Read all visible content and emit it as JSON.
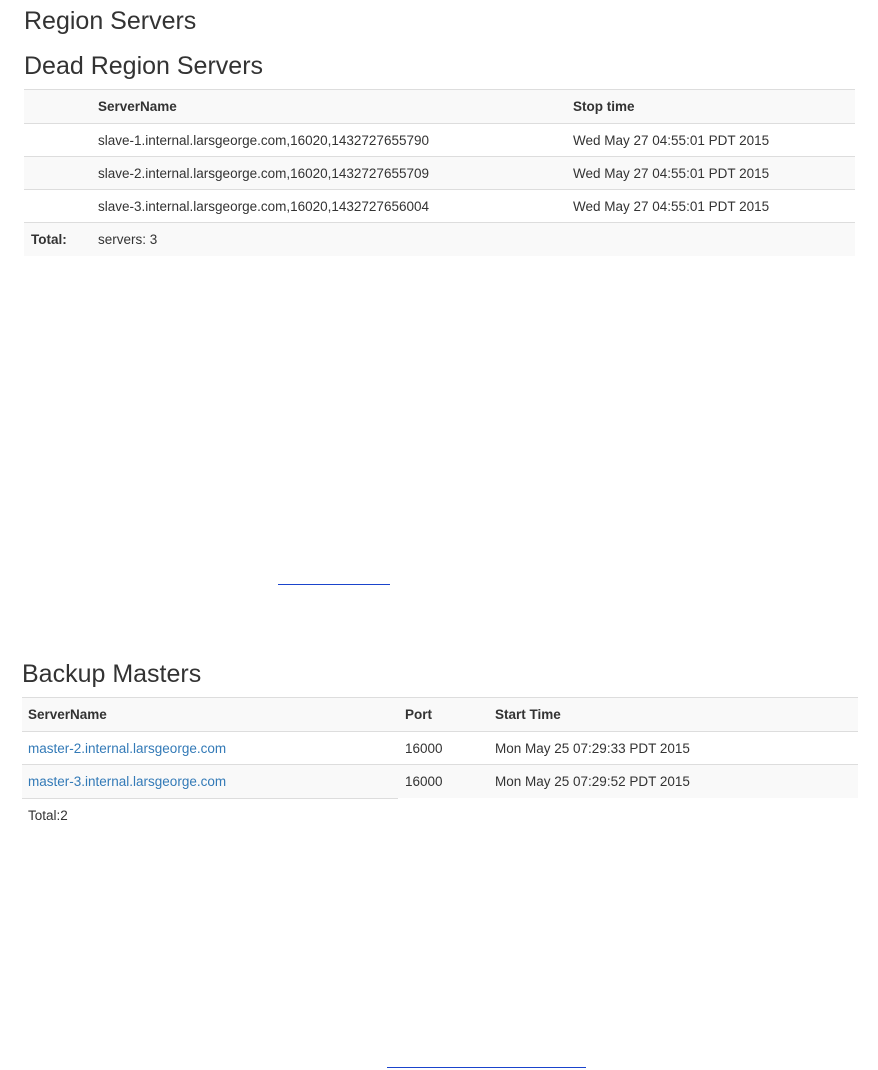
{
  "region_servers": {
    "title": "Region Servers"
  },
  "dead_region_servers": {
    "title": "Dead Region Servers",
    "columns": [
      "",
      "ServerName",
      "Stop time"
    ],
    "rows": [
      {
        "server": "slave-1.internal.larsgeorge.com,16020,1432727655790",
        "stop_time": "Wed May 27 04:55:01 PDT 2015"
      },
      {
        "server": "slave-2.internal.larsgeorge.com,16020,1432727655709",
        "stop_time": "Wed May 27 04:55:01 PDT 2015"
      },
      {
        "server": "slave-3.internal.larsgeorge.com,16020,1432727656004",
        "stop_time": "Wed May 27 04:55:01 PDT 2015"
      }
    ],
    "total_label": "Total:",
    "total_value": "servers: 3"
  },
  "backup_masters": {
    "title": "Backup Masters",
    "columns": [
      "ServerName",
      "Port",
      "Start Time"
    ],
    "rows": [
      {
        "server": "master-2.internal.larsgeorge.com",
        "port": "16000",
        "start_time": "Mon May 25 07:29:33 PDT 2015"
      },
      {
        "server": "master-3.internal.larsgeorge.com",
        "port": "16000",
        "start_time": "Mon May 25 07:29:52 PDT 2015"
      }
    ],
    "total": "Total:2"
  },
  "colors": {
    "link": "#337ab7",
    "stripe": "#f9f9f9",
    "border": "#dddddd",
    "text": "#333333"
  }
}
